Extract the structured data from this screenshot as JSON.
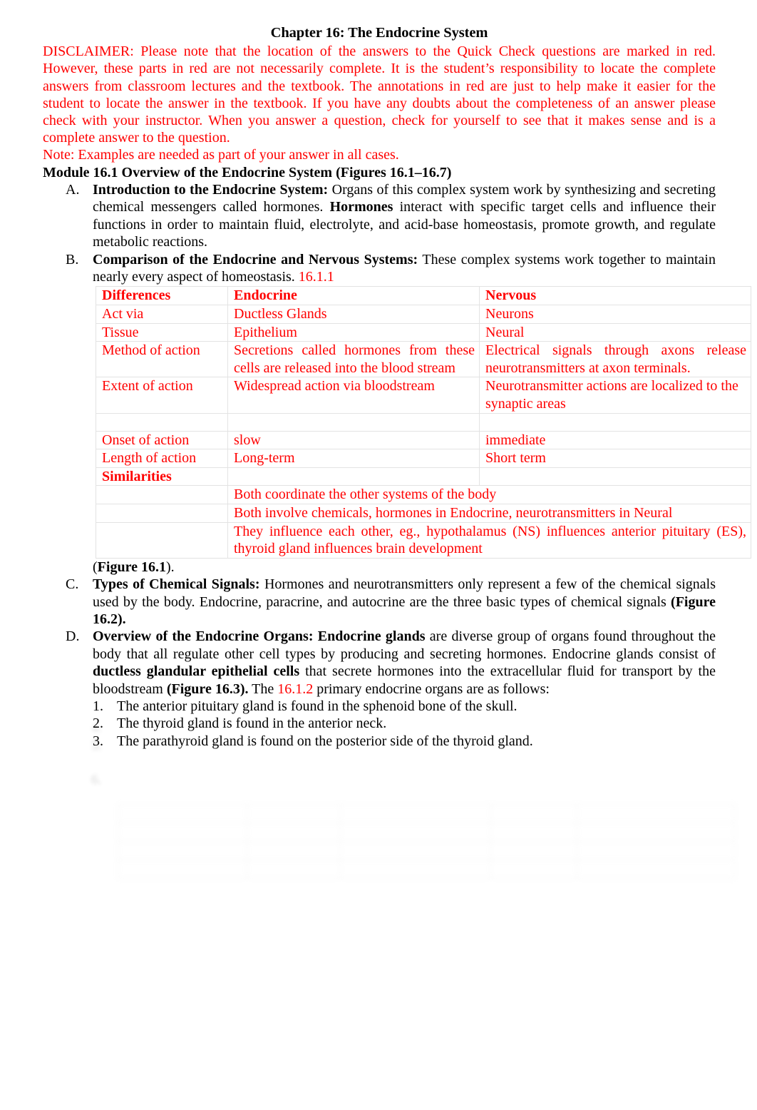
{
  "document": {
    "title": "Chapter 16: The Endocrine System",
    "disclaimer": "DISCLAIMER: Please note that the location of the answers to the Quick Check questions are marked in red. However, these parts in red are not necessarily complete. It is the student’s responsibility to locate the complete answers from classroom lectures and the textbook. The annotations in red are just to help make it easier for the student to locate the answer in the textbook. If you have any doubts about the completeness of an answer please check with your instructor. When you answer a question, check for yourself to see that it makes sense and is a complete answer to the question.",
    "note": "Note: Examples are needed as part of your answer in all cases.",
    "module_heading": "Module 16.1 Overview of the Endocrine System (Figures 16.1–16.7)"
  },
  "outline": {
    "a": {
      "marker": "A.",
      "heading": "Introduction to the Endocrine System:",
      "text_1": " Organs of this complex system work by synthesizing and secreting chemical messengers called hormones. ",
      "bold_2": "Hormones",
      "text_2": " interact with specific target cells and influence their functions in order to maintain fluid, electrolyte, and acid-base homeostasis, promote growth, and regulate metabolic reactions."
    },
    "b": {
      "marker": "B.",
      "heading": "Comparison of the Endocrine and Nervous Systems:",
      "text_1": " These complex systems work together to maintain nearly every aspect of homeostasis. ",
      "annotation": "16.1.1",
      "figure_ref_bold": "Figure 16.1",
      "figure_open": "(",
      "figure_close": ")."
    },
    "c": {
      "marker": "C.",
      "heading": "Types of Chemical Signals:",
      "text_1": " Hormones and neurotransmitters only represent a few of the chemical signals used by the body. Endocrine, paracrine, and autocrine are the three basic types of chemical signals ",
      "bold_2": "(Figure 16.2)."
    },
    "d": {
      "marker": "D.",
      "heading": "Overview of the Endocrine Organs: Endocrine glands",
      "text_1": " are diverse group of organs found throughout the body that all regulate other cell types by producing and secreting hormones. Endocrine glands consist of ",
      "bold_2": "ductless glandular epithelial cells",
      "text_2": " that secrete hormones into the extracellular fluid for transport by the bloodstream ",
      "bold_3": "(Figure 16.3).",
      "text_3": " The ",
      "annotation": "16.1.2",
      "text_4": " primary endocrine organs are as follows:"
    }
  },
  "numbered_list": [
    {
      "marker": "1.",
      "text": "The anterior pituitary gland is found in the sphenoid bone of the skull."
    },
    {
      "marker": "2.",
      "text": "The thyroid gland is found in the anterior neck."
    },
    {
      "marker": "3.",
      "text": "The parathyroid gland is found on the posterior side of the thyroid gland."
    }
  ],
  "comparison_table": {
    "headers": {
      "col1": "Differences",
      "col2": "Endocrine",
      "col3": "Nervous"
    },
    "rows": [
      {
        "col1": "Act via",
        "col2": "Ductless Glands",
        "col3": "Neurons"
      },
      {
        "col1": "Tissue",
        "col2": "Epithelium",
        "col3": "Neural"
      },
      {
        "col1": "Method of action",
        "col2": "Secretions called hormones from these cells are released into the blood stream",
        "col3": "Electrical signals through axons release neurotransmitters at axon terminals."
      },
      {
        "col1": "Extent of action",
        "col2": "Widespread action via bloodstream",
        "col3": "Neurotransmitter actions are localized to the synaptic areas"
      },
      {
        "col1": "Onset of action",
        "col2": "slow",
        "col3": "immediate"
      },
      {
        "col1": "Length of action",
        "col2": "Long-term",
        "col3": "Short term"
      }
    ],
    "similarities_label": "Similarities",
    "similarities": [
      "Both coordinate the other systems of the body",
      "Both involve chemicals, hormones in Endocrine, neurotransmitters in Neural",
      "They influence each other, eg., hypothalamus (NS) influences anterior pituitary (ES), thyroid gland influences brain development"
    ]
  },
  "faded_region": {
    "note": "illegible faded continuation of page",
    "line_1": "4.",
    "line_2": "5.",
    "line_3": "6.",
    "heading": "",
    "table_cells": [
      "",
      "",
      "",
      "",
      ""
    ]
  }
}
